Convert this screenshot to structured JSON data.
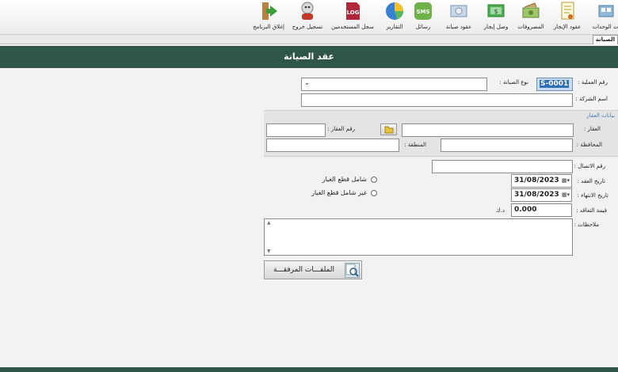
{
  "toolbar": {
    "items": [
      {
        "label": "ات الوحدات",
        "icon": "units-icon"
      },
      {
        "label": "عقود الإيجار",
        "icon": "lease-contracts-icon"
      },
      {
        "label": "المصروفات",
        "icon": "expenses-icon"
      },
      {
        "label": "وصل إيجار",
        "icon": "rent-receipt-icon"
      },
      {
        "label": "عقود صيانة",
        "icon": "maintenance-contracts-icon"
      },
      {
        "label": "رسائل",
        "icon": "sms-icon"
      },
      {
        "label": "التقارير",
        "icon": "reports-icon"
      },
      {
        "label": "سجل المستخدمين",
        "icon": "log-icon"
      },
      {
        "label": "تسجيل خروج",
        "icon": "logout-icon"
      },
      {
        "label": "إغلاق البرنامج",
        "icon": "exit-icon"
      }
    ]
  },
  "tab": {
    "label": "الصيانة"
  },
  "page": {
    "title": "عقد الصيانة"
  },
  "form": {
    "operation_no_label": "رقم العملية :",
    "operation_no_value": "S-0001",
    "maintenance_type_label": "نوع الصيانة :",
    "company_name_label": "اسم الشركة :",
    "property_section_title": "بيانات العقار",
    "property_label": "العقار :",
    "property_no_label": "رقم العقار :",
    "governorate_label": "المحافظة :",
    "region_label": "المنطقة :",
    "contact_no_label": "رقم الاتصال :",
    "contract_date_label": "تاريخ العقد :",
    "contract_date_value": "31/08/2023",
    "end_date_label": "تاريخ الانتهاء :",
    "end_date_value": "31/08/2023",
    "contract_value_label": "قيمة التعاقد :",
    "contract_value_value": "0.000",
    "currency_label": "د.ك",
    "radio_incl_parts": "شامل قطع الغيار",
    "radio_excl_parts": "غير شامل قطع الغيار",
    "notes_label": "ملاحظات :",
    "attachments_label": "الملفـــات المرفقـــة"
  },
  "colors": {
    "header_bg": "#2f5448",
    "section_title": "#4a7fb5"
  }
}
